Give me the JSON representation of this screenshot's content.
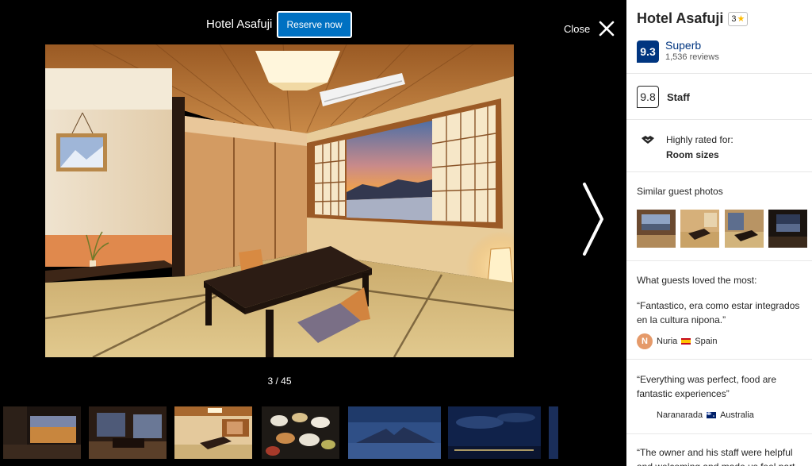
{
  "gallery": {
    "hotel_title": "Hotel Asafuji",
    "reserve_label": "Reserve now",
    "close_label": "Close",
    "counter": "3 / 45"
  },
  "sidebar": {
    "title": "Hotel Asafuji",
    "stars": "3",
    "score": "9.3",
    "score_word": "Superb",
    "reviews": "1,536 reviews",
    "staff_score": "9.8",
    "staff_label": "Staff",
    "highly_rated_label": "Highly rated for:",
    "highly_rated_value": "Room sizes",
    "similar_photos_title": "Similar guest photos",
    "loved_title": "What guests loved the most:",
    "reviews_list": [
      {
        "quote": "“Fantastico, era como estar integrados en la cultura nipona.”",
        "avatar": "N",
        "name": "Nuria",
        "country": "Spain"
      },
      {
        "quote": "“Everything was perfect, food are fantastic experiences”",
        "avatar": "",
        "name": "Naranarada",
        "country": "Australia"
      },
      {
        "quote": "“The owner and his staff were helpful and welcoming and made us feel part",
        "avatar": "",
        "name": "",
        "country": ""
      }
    ]
  },
  "colors": {
    "brand_blue": "#003580",
    "button_blue": "#0071c2",
    "star_yellow": "#febb02"
  }
}
